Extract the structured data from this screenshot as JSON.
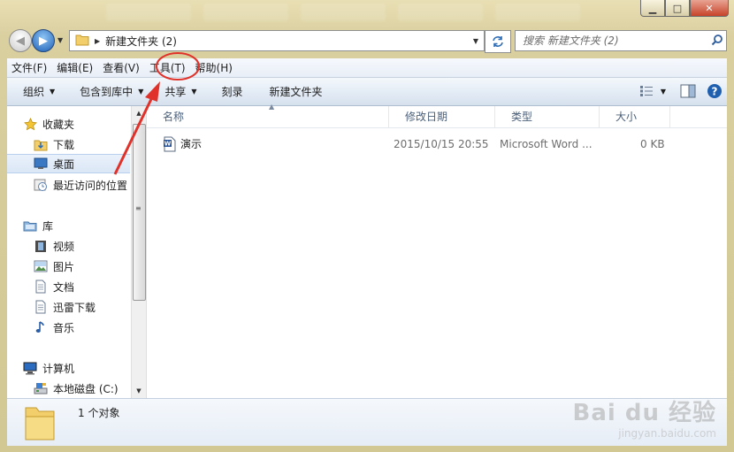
{
  "window": {
    "caption": {
      "minimize": "▁",
      "maximize": "□",
      "close": "✕"
    }
  },
  "address": {
    "path": "新建文件夹 (2)",
    "search_placeholder": "搜索 新建文件夹 (2)"
  },
  "menu": [
    {
      "label": "文件(F)"
    },
    {
      "label": "编辑(E)"
    },
    {
      "label": "查看(V)"
    },
    {
      "label": "工具(T)"
    },
    {
      "label": "帮助(H)"
    }
  ],
  "commands": {
    "organize": "组织",
    "include_in_library": "包含到库中",
    "share": "共享",
    "burn": "刻录",
    "new_folder": "新建文件夹"
  },
  "nav": {
    "favorites": {
      "label": "收藏夹",
      "icon": "star-icon"
    },
    "downloads": {
      "label": "下载",
      "icon": "download-folder-icon"
    },
    "desktop": {
      "label": "桌面",
      "icon": "desktop-icon"
    },
    "recent": {
      "label": "最近访问的位置",
      "icon": "recent-places-icon"
    },
    "libraries": {
      "label": "库",
      "icon": "library-icon"
    },
    "videos": {
      "label": "视频",
      "icon": "video-icon"
    },
    "pictures": {
      "label": "图片",
      "icon": "picture-icon"
    },
    "documents": {
      "label": "文档",
      "icon": "document-icon"
    },
    "xunlei": {
      "label": "迅雷下载",
      "icon": "xunlei-icon"
    },
    "music": {
      "label": "音乐",
      "icon": "music-icon"
    },
    "computer": {
      "label": "计算机",
      "icon": "computer-icon"
    },
    "local_disk": {
      "label": "本地磁盘 (C:)",
      "icon": "hard-disk-icon"
    }
  },
  "columns": {
    "name": "名称",
    "modified": "修改日期",
    "type": "类型",
    "size": "大小"
  },
  "files": [
    {
      "name": "演示",
      "modified": "2015/10/15 20:55",
      "type": "Microsoft Word ...",
      "size": "0 KB",
      "icon": "word-document-icon"
    }
  ],
  "details": {
    "count": "1 个对象"
  },
  "watermark": {
    "brand": "Bai du 经验",
    "url": "jingyan.baidu.com"
  },
  "colors": {
    "annotation": "#e0322a",
    "accent": "#1d5fb5",
    "selection": "#dbe7f6"
  }
}
